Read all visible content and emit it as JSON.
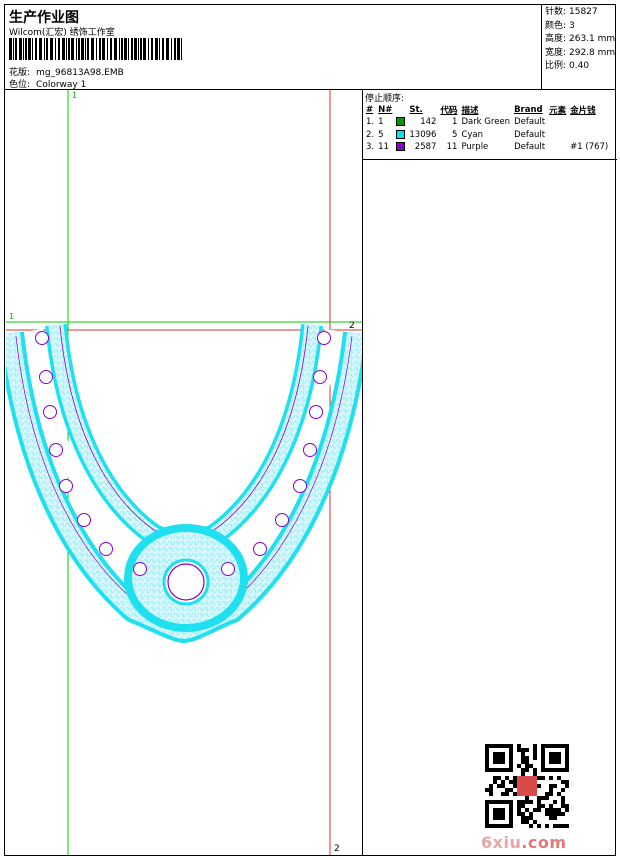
{
  "header": {
    "title": "生产作业图",
    "subtitle": "Wilcom(汇宏) 绣饰工作室",
    "design_label": "花版:",
    "design_name": "mg_96813A98.EMB",
    "colorway_label": "色位:",
    "colorway_name": "Colorway 1"
  },
  "stats": [
    {
      "label": "针数:",
      "value": "15827"
    },
    {
      "label": "颜色:",
      "value": "3"
    },
    {
      "label": "高度:",
      "value": "263.1 mm"
    },
    {
      "label": "宽度:",
      "value": "292.8 mm"
    },
    {
      "label": "比例:",
      "value": "0.40"
    }
  ],
  "stop_sequence": {
    "title": "停止顺序:",
    "columns": [
      "#",
      "N#",
      "St.",
      "代码",
      "描述",
      "Brand",
      "元素",
      "金片钱"
    ],
    "rows": [
      {
        "idx": "1.",
        "n": "1",
        "color": "#009900",
        "st": "142",
        "code": "1",
        "desc": "Dark Green",
        "brand": "Default",
        "elem": "",
        "sequin": ""
      },
      {
        "idx": "2.",
        "n": "5",
        "color": "#00e5f2",
        "st": "13096",
        "code": "5",
        "desc": "Cyan",
        "brand": "Default",
        "elem": "",
        "sequin": ""
      },
      {
        "idx": "3.",
        "n": "11",
        "color": "#8800cc",
        "st": "2587",
        "code": "11",
        "desc": "Purple",
        "brand": "Default",
        "elem": "",
        "sequin": "#1 (767)"
      }
    ]
  },
  "guides": {
    "v1_label": "1",
    "h1_label": "1",
    "h2_label": "2",
    "v2_label": "2",
    "green": "#00cc00",
    "red": "#dd3333"
  },
  "design_colors": {
    "cyan": "#1fe0ee",
    "fill": "#bff3f8",
    "purple": "#8800cc"
  },
  "watermark": {
    "site_prefix": "6xiu",
    "site_suffix": ".com"
  }
}
